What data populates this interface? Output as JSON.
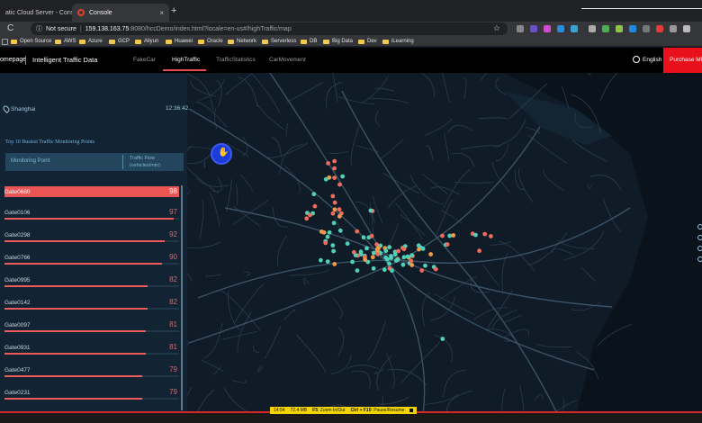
{
  "browser": {
    "tabs": [
      {
        "title": "atic Cloud Server - Console",
        "close": "×"
      },
      {
        "title": "Console",
        "close": "×"
      }
    ],
    "new_tab": "+",
    "nav": {
      "back": "←",
      "forward": "→",
      "reload": "C"
    },
    "address": {
      "security_label": "Not secure",
      "url_host": "159.138.163.75",
      "url_path": ":8080/hccDemo/index.html?locale=en-us#/highTraffic/map"
    },
    "bookmarks": [
      {
        "label": "Open Source"
      },
      {
        "label": "AWS"
      },
      {
        "label": "Azure"
      },
      {
        "label": "GCP"
      },
      {
        "label": "Aliyun"
      },
      {
        "label": "Huawei"
      },
      {
        "label": "Oracle"
      },
      {
        "label": "Network"
      },
      {
        "label": "Serverless"
      },
      {
        "label": "DB"
      },
      {
        "label": "Big Data"
      },
      {
        "label": "Dev"
      },
      {
        "label": "iLearning"
      }
    ]
  },
  "app": {
    "home": "omepage",
    "brand": "Intelligent Traffic Data",
    "tabs": [
      {
        "label": "FakeCar"
      },
      {
        "label": "HighTraffic",
        "active": true
      },
      {
        "label": "TrafficStatistics"
      },
      {
        "label": "CarMovement"
      }
    ],
    "language": "English",
    "purchase": "Purchase MR"
  },
  "panel": {
    "city": "Shanghai",
    "time": "12:36:42",
    "title": "Top 10 Busiest Traffic Monitoring Points",
    "col_point": "Monitoring Point",
    "col_flow": "Traffic Flow (vehicles/min)",
    "rows": [
      {
        "name": "Gate0680",
        "value": 98
      },
      {
        "name": "Gate0106",
        "value": 97
      },
      {
        "name": "Gate0298",
        "value": 92
      },
      {
        "name": "Gate0766",
        "value": 90
      },
      {
        "name": "Gate0995",
        "value": 82
      },
      {
        "name": "Gate0142",
        "value": 82
      },
      {
        "name": "Gate0097",
        "value": 81
      },
      {
        "name": "Gate0931",
        "value": 81
      },
      {
        "name": "Gate0477",
        "value": 79
      },
      {
        "name": "Gate0231",
        "value": 79
      }
    ]
  },
  "status_bar": {
    "time": "14:54",
    "size": "72.4 MB",
    "key1": "F5",
    "key1_action": ": Zoom In/Out",
    "key2": "Ctrl + F10",
    "key2_action": ": Pause/Resume"
  },
  "colors": {
    "accent_red": "#ea5455",
    "marker_teal": "#4fd1b5",
    "marker_red": "#f06b5b",
    "marker_orange": "#f39a4a"
  }
}
